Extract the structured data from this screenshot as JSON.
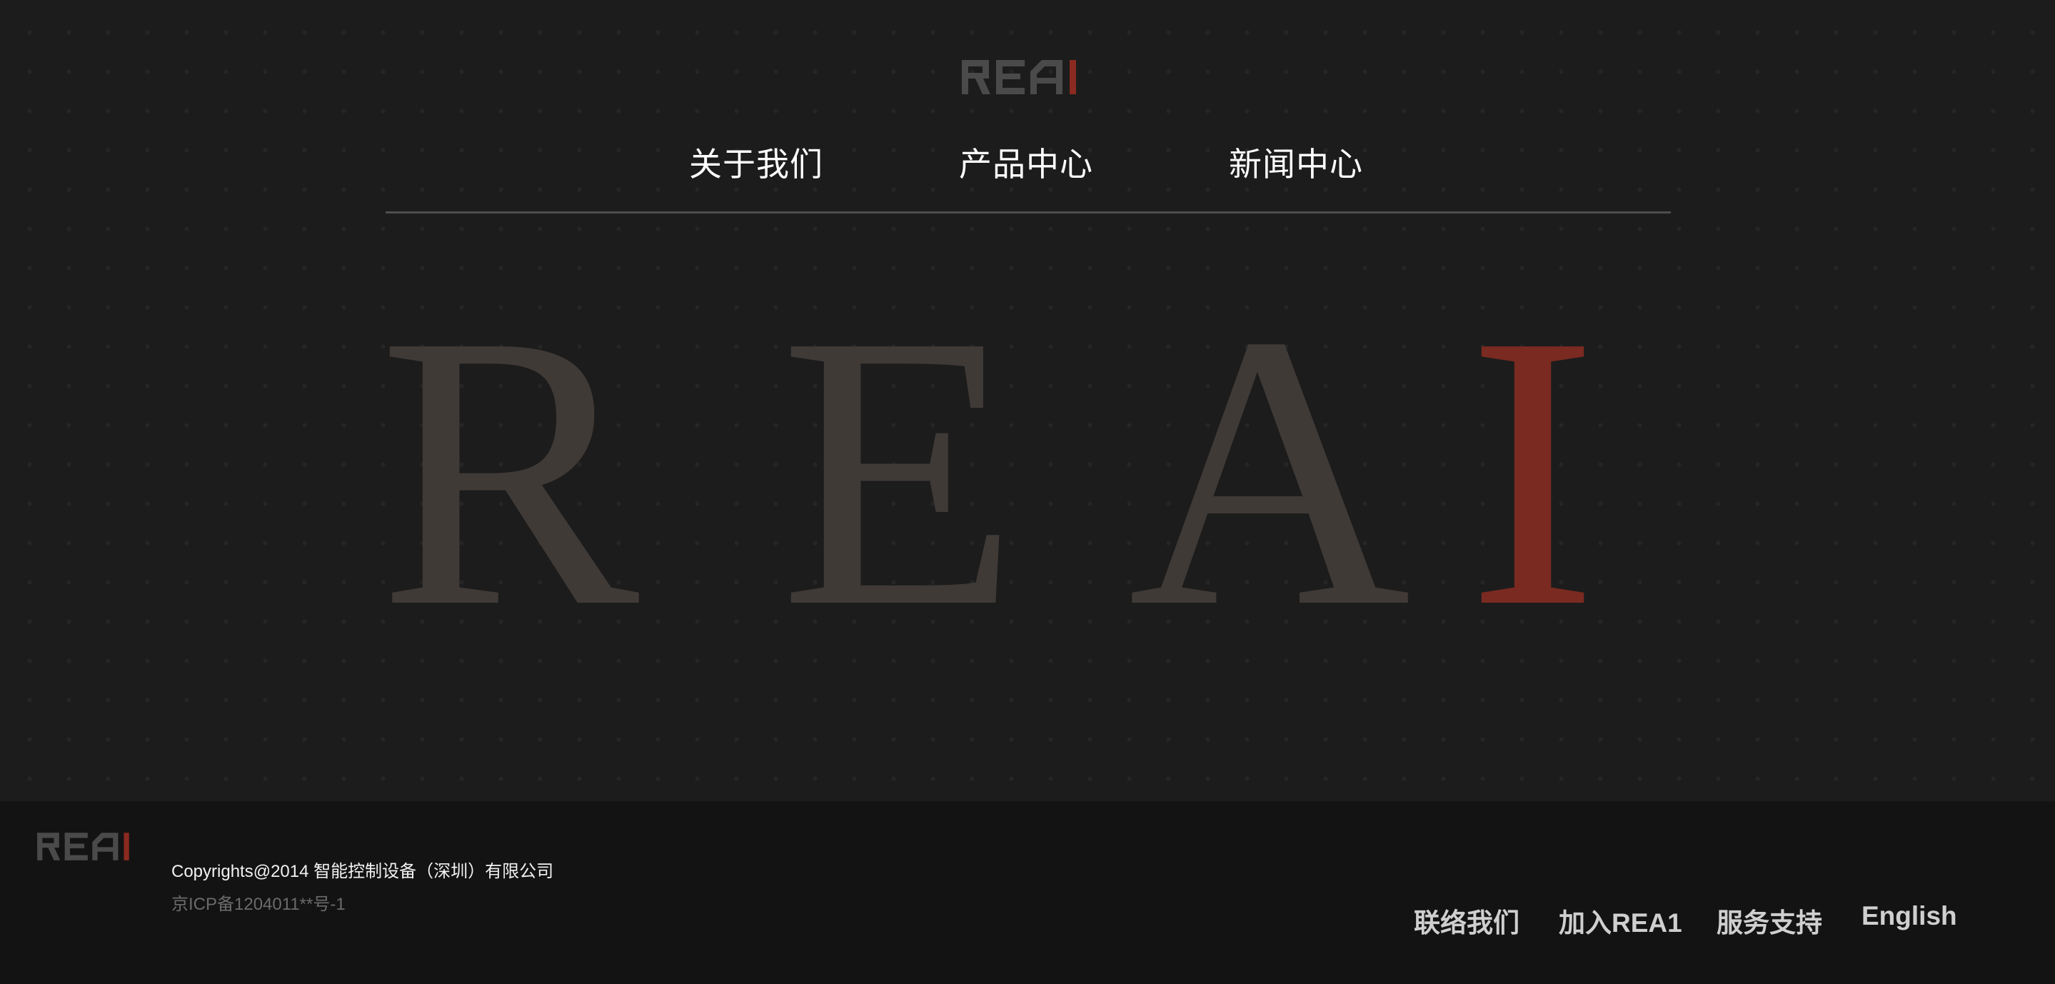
{
  "brand": {
    "logo_text": "REAI",
    "logo_gray_color": "#4a4a4a",
    "logo_accent_color": "#8b2a20"
  },
  "nav": {
    "items": [
      {
        "label": "关于我们"
      },
      {
        "label": "产品中心"
      },
      {
        "label": "新闻中心"
      }
    ]
  },
  "hero": {
    "letters": [
      "R",
      "E",
      "A",
      "I"
    ],
    "letter_color": "#403a37",
    "accent_color": "#7a2a21"
  },
  "footer": {
    "copyright": "Copyrights@2014 智能控制设备（深圳）有限公司",
    "icp": "京ICP备1204011**号-1",
    "links": [
      {
        "label": "联络我们"
      },
      {
        "label": "加入REA1"
      },
      {
        "label": "服务支持"
      },
      {
        "label": "English"
      }
    ]
  }
}
